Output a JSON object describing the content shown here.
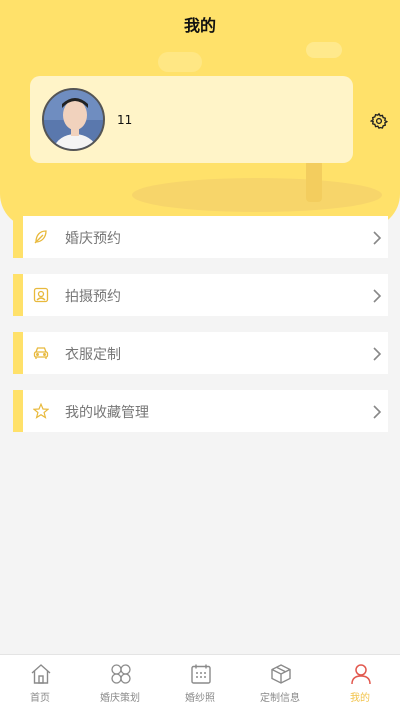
{
  "header": {
    "title": "我的"
  },
  "profile": {
    "username": "11",
    "avatar_icon": "avatar-photo"
  },
  "menu": [
    {
      "label": "婚庆预约",
      "icon": "leaf-icon"
    },
    {
      "label": "拍摄预约",
      "icon": "portrait-icon"
    },
    {
      "label": "衣服定制",
      "icon": "car-icon"
    },
    {
      "label": "我的收藏管理",
      "icon": "star-icon"
    }
  ],
  "tabbar": [
    {
      "label": "首页",
      "icon": "home-icon",
      "active": false
    },
    {
      "label": "婚庆策划",
      "icon": "clover-icon",
      "active": false
    },
    {
      "label": "婚纱照",
      "icon": "calendar-icon",
      "active": false
    },
    {
      "label": "定制信息",
      "icon": "box-icon",
      "active": false
    },
    {
      "label": "我的",
      "icon": "person-icon",
      "active": true
    }
  ],
  "colors": {
    "accent_yellow": "#ffe16a",
    "card_bg": "#fff4c8",
    "active_tab_label": "#f2c34a",
    "active_tab_icon": "#e2584e",
    "page_bg": "#f4f4f4"
  }
}
